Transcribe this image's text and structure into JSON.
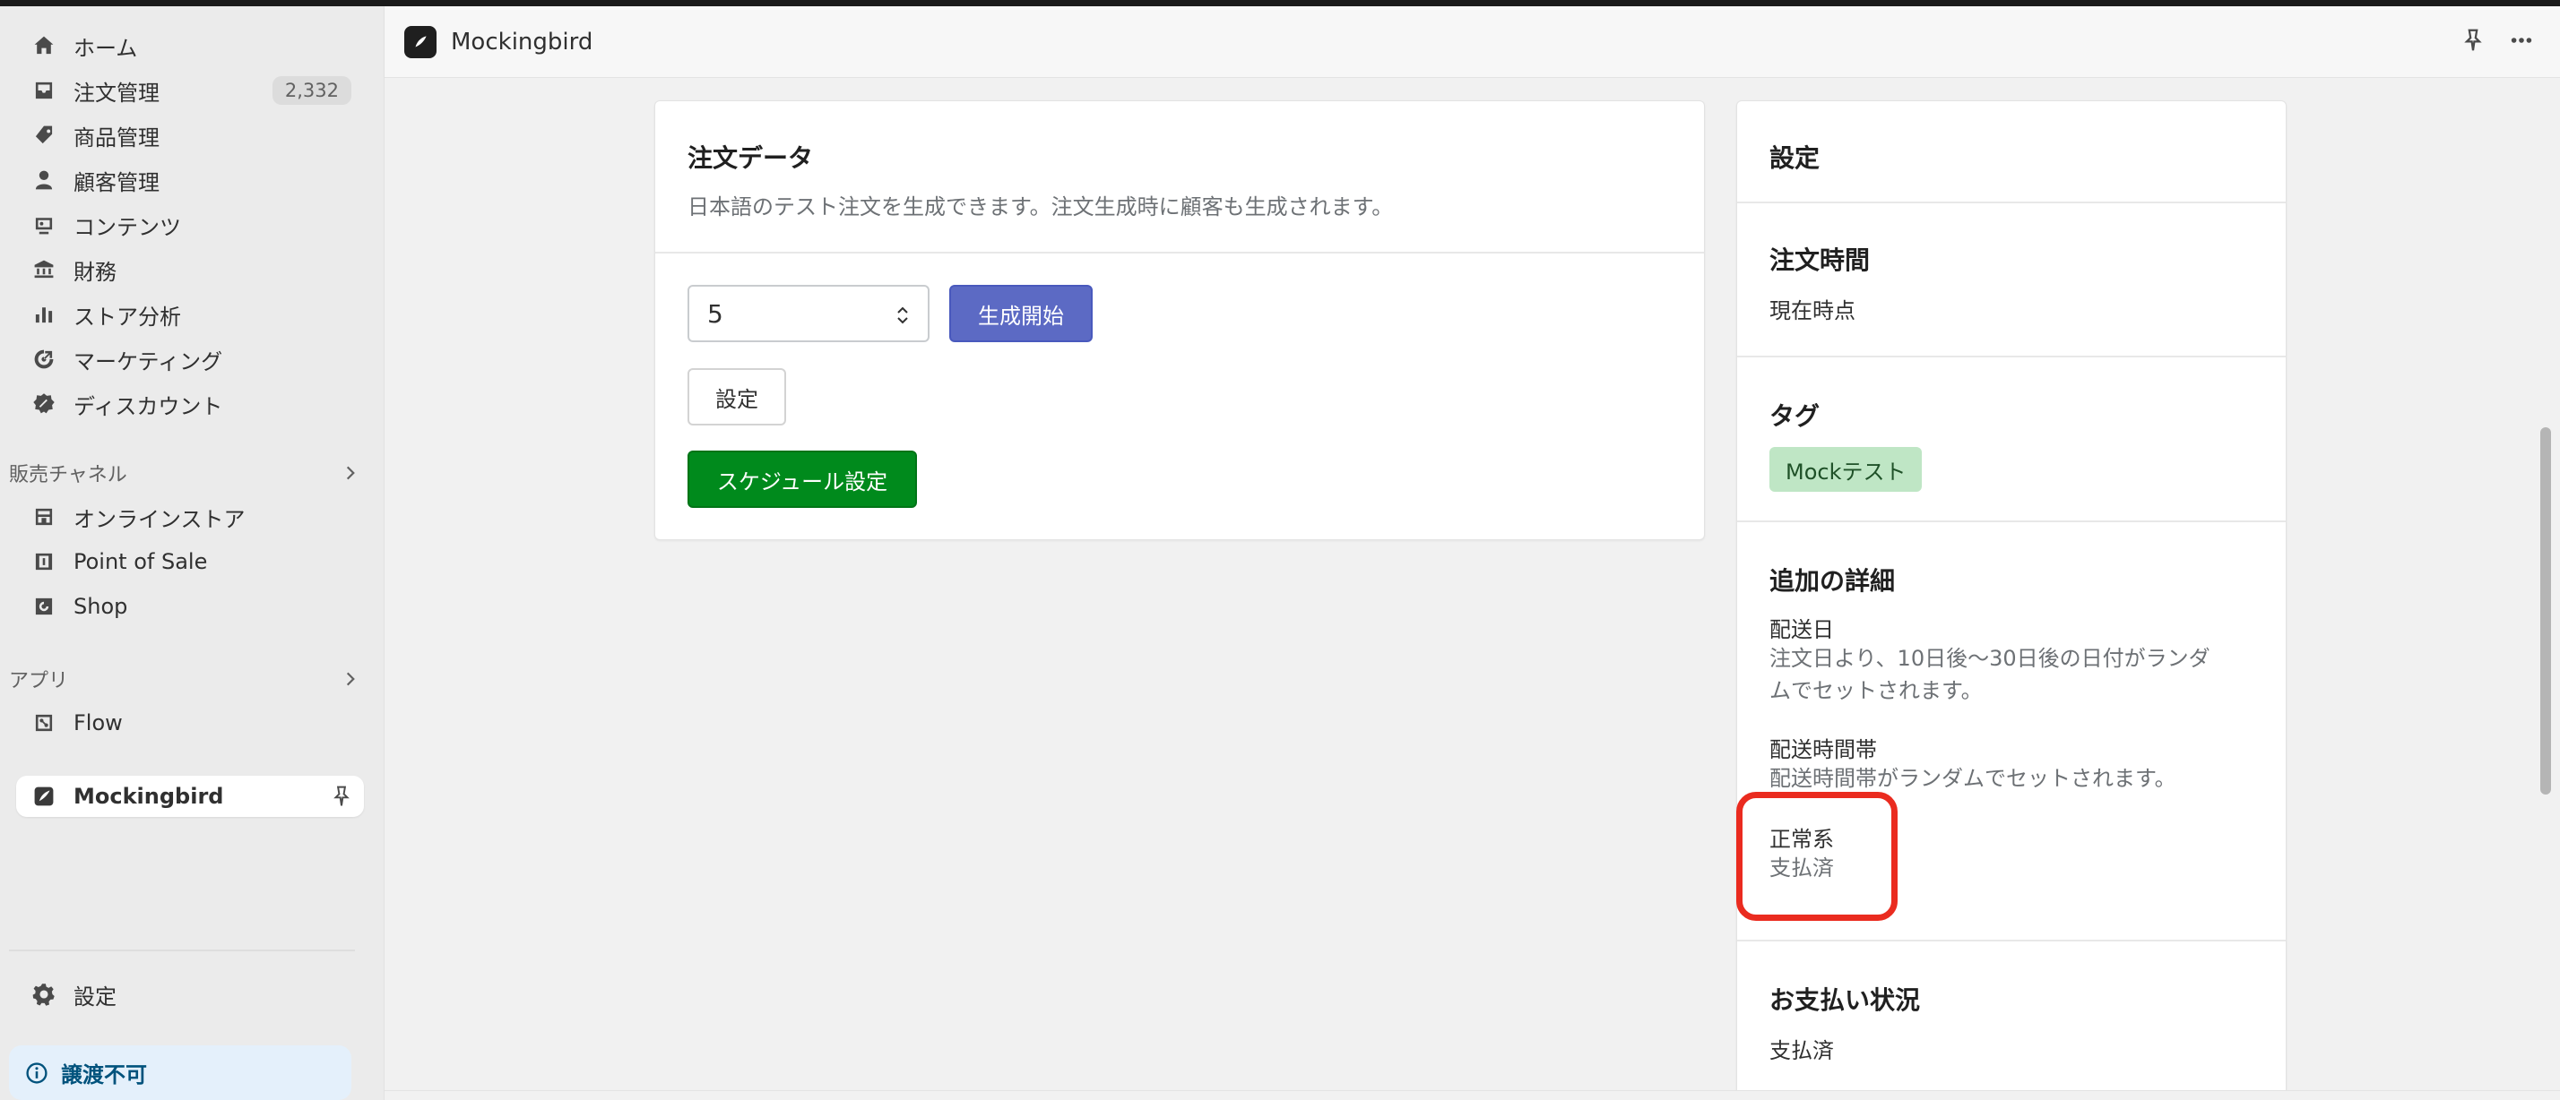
{
  "sidebar": {
    "items": [
      {
        "label": "ホーム",
        "icon": "home-icon"
      },
      {
        "label": "注文管理",
        "icon": "inbox-icon",
        "badge": "2,332"
      },
      {
        "label": "商品管理",
        "icon": "tag-icon"
      },
      {
        "label": "顧客管理",
        "icon": "person-icon"
      },
      {
        "label": "コンテンツ",
        "icon": "content-icon"
      },
      {
        "label": "財務",
        "icon": "bank-icon"
      },
      {
        "label": "ストア分析",
        "icon": "bar-chart-icon"
      },
      {
        "label": "マーケティング",
        "icon": "target-icon"
      },
      {
        "label": "ディスカウント",
        "icon": "discount-icon"
      }
    ],
    "sales_channels": {
      "heading": "販売チャネル",
      "items": [
        {
          "label": "オンラインストア",
          "icon": "store-icon"
        },
        {
          "label": "Point of Sale",
          "icon": "pos-icon"
        },
        {
          "label": "Shop",
          "icon": "shop-icon"
        }
      ]
    },
    "apps": {
      "heading": "アプリ",
      "items": [
        {
          "label": "Flow",
          "icon": "flow-icon"
        }
      ]
    },
    "pinned_app": {
      "label": "Mockingbird",
      "icon": "mockingbird-icon"
    },
    "settings_label": "設定",
    "nontransfer_label": "譲渡不可"
  },
  "header": {
    "app_title": "Mockingbird"
  },
  "order_card": {
    "title": "注文データ",
    "description": "日本語のテスト注文を生成できます。注文生成時に顧客も生成されます。",
    "quantity_value": "5",
    "generate_label": "生成開始",
    "settings_label": "設定",
    "schedule_label": "スケジュール設定"
  },
  "settings_card": {
    "title": "設定",
    "order_time": {
      "label": "注文時間",
      "value": "現在時点"
    },
    "tags": {
      "label": "タグ",
      "value": "Mockテスト"
    },
    "additional": {
      "label": "追加の詳細",
      "delivery_date": {
        "label": "配送日",
        "value": "注文日より、10日後〜30日後の日付がランダムでセットされます。"
      },
      "delivery_time": {
        "label": "配送時間帯",
        "value": "配送時間帯がランダムでセットされます。"
      },
      "normal": {
        "label": "正常系",
        "value": "支払済"
      }
    },
    "payment_status": {
      "label": "お支払い状況",
      "value": "支払済"
    }
  },
  "colors": {
    "primary_button": "#5c6ac4",
    "green_button": "#008a1c",
    "tag_background": "#bfe6c5",
    "highlight": "#ea2b1f"
  }
}
